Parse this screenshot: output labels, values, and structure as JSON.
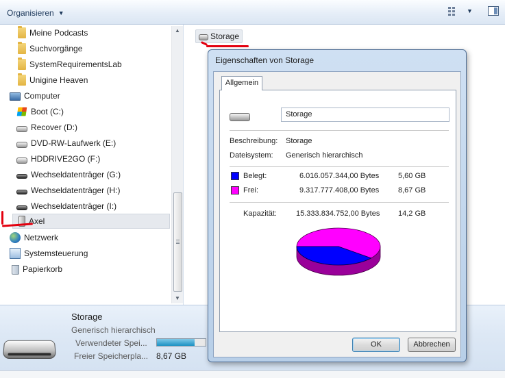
{
  "toolbar": {
    "organize_label": "Organisieren"
  },
  "nav": {
    "items": [
      {
        "label": "Meine Podcasts",
        "icon": "folder-icon"
      },
      {
        "label": "Suchvorgänge",
        "icon": "folder-icon"
      },
      {
        "label": "SystemRequirementsLab",
        "icon": "folder-icon"
      },
      {
        "label": "Unigine Heaven",
        "icon": "folder-icon"
      },
      {
        "label": "Computer",
        "icon": "computer-icon"
      },
      {
        "label": "Boot (C:)",
        "icon": "windows-drive-icon"
      },
      {
        "label": "Recover (D:)",
        "icon": "drive-icon"
      },
      {
        "label": "DVD-RW-Laufwerk (E:)",
        "icon": "drive-icon"
      },
      {
        "label": "HDDRIVE2GO (F:)",
        "icon": "drive-icon"
      },
      {
        "label": "Wechseldatenträger (G:)",
        "icon": "removable-drive-icon"
      },
      {
        "label": "Wechseldatenträger (H:)",
        "icon": "removable-drive-icon"
      },
      {
        "label": "Wechseldatenträger (I:)",
        "icon": "removable-drive-icon"
      },
      {
        "label": "Axel",
        "icon": "device-icon"
      },
      {
        "label": "Netzwerk",
        "icon": "network-icon"
      },
      {
        "label": "Systemsteuerung",
        "icon": "control-panel-icon"
      },
      {
        "label": "Papierkorb",
        "icon": "recycle-bin-icon"
      }
    ]
  },
  "content": {
    "item_label": "Storage"
  },
  "details": {
    "name": "Storage",
    "type": "Generisch hierarchisch",
    "used_label": "Verwendeter Spei...",
    "used_fraction": 0.78,
    "free_label": "Freier Speicherpla...",
    "free_value": "8,67 GB"
  },
  "dialog": {
    "title": "Eigenschaften von Storage",
    "tab_label": "Allgemein",
    "name_value": "Storage",
    "desc_label": "Beschreibung:",
    "desc_value": "Storage",
    "fs_label": "Dateisystem:",
    "fs_value": "Generisch hierarchisch",
    "used_label": "Belegt:",
    "used_bytes": "6.016.057.344,00 Bytes",
    "used_gb": "5,60 GB",
    "free_label": "Frei:",
    "free_bytes": "9.317.777.408,00 Bytes",
    "free_gb": "8,67 GB",
    "cap_label": "Kapazität:",
    "cap_bytes": "15.333.834.752,00 Bytes",
    "cap_gb": "14,2 GB",
    "ok_label": "OK",
    "cancel_label": "Abbrechen",
    "used_color": "#0000ff",
    "free_color": "#ff00ff",
    "used_value": 6016057344,
    "free_value": 9317777408
  }
}
